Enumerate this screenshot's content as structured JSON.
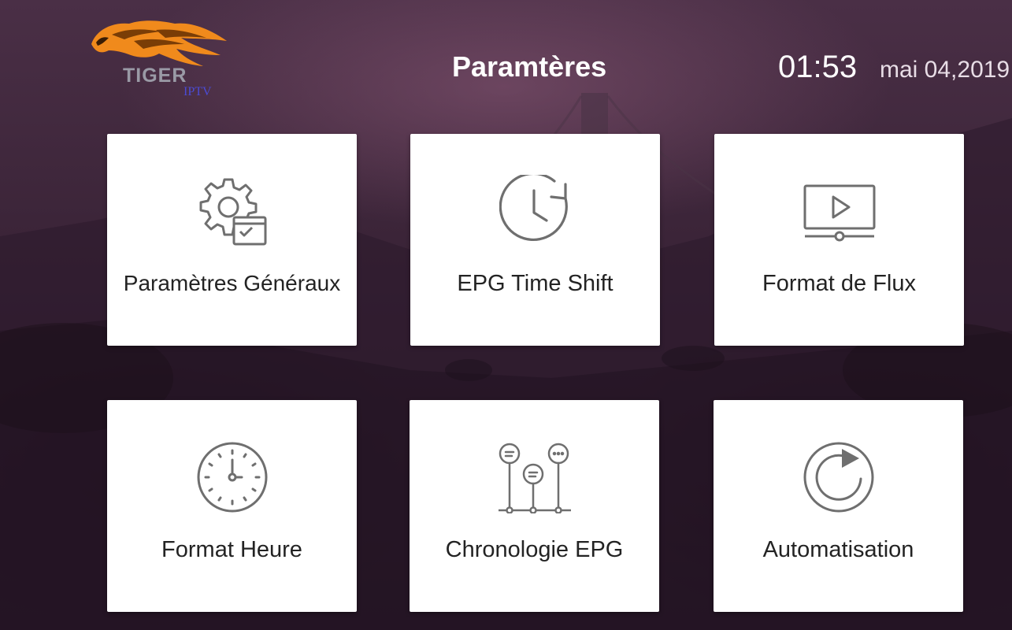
{
  "brand": {
    "name": "TIGER",
    "sub": "IPTV"
  },
  "header": {
    "title": "Paramtères",
    "time": "01:53",
    "date": "mai 04,2019"
  },
  "colors": {
    "tile_bg": "#ffffff",
    "icon_stroke": "#6f6f6f",
    "label": "#232323",
    "logo_flame": "#f08a1c"
  },
  "tiles": [
    {
      "label": "Paramètres Généraux",
      "icon": "gear-settings-icon"
    },
    {
      "label": "EPG Time Shift",
      "icon": "clock-refresh-icon"
    },
    {
      "label": "Format de Flux",
      "icon": "video-player-icon"
    },
    {
      "label": "Format Heure",
      "icon": "wall-clock-icon"
    },
    {
      "label": "Chronologie EPG",
      "icon": "timeline-icon"
    },
    {
      "label": "Automatisation",
      "icon": "auto-refresh-icon"
    }
  ]
}
